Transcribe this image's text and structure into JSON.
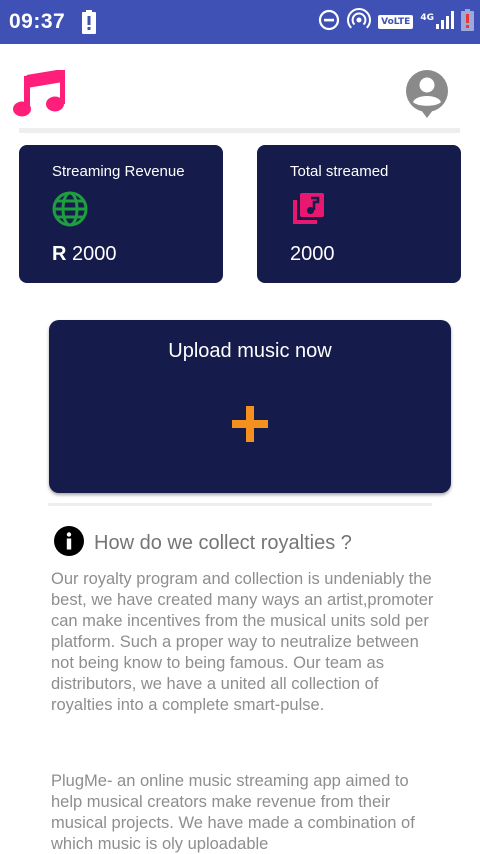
{
  "status_bar": {
    "time": "09:37",
    "volte": "VoLTE",
    "network": "4G",
    "background_color": "#3f51b5"
  },
  "header": {
    "logo_icon": "music-note-icon",
    "logo_color": "#ff1f7a",
    "avatar_icon": "account-circle-icon"
  },
  "cards": {
    "revenue": {
      "title": "Streaming Revenue",
      "icon": "globe-icon",
      "icon_color": "#1e9e3e",
      "currency": "R",
      "value": "2000"
    },
    "streamed": {
      "title": "Total streamed",
      "icon": "music-library-icon",
      "icon_color": "#e8176f",
      "value": "2000"
    },
    "background_color": "#151b4a"
  },
  "upload": {
    "title": "Upload music now",
    "icon": "plus-icon",
    "icon_color": "#f4901e"
  },
  "info": {
    "icon": "info-icon",
    "heading": "How do we collect royalties ?",
    "paragraphs": [
      "Our royalty program and collection is undeniably the best, we have created many ways an artist,promoter can make incentives from the musical units sold per platform. Such a proper way to neutralize between not being know to being famous. Our team as distributors, we have a united all collection of royalties into a complete smart-pulse.",
      "PlugMe- an online music streaming app aimed to help musical creators make revenue from their musical projects. We have made a combination of which music is oly uploadable"
    ]
  }
}
